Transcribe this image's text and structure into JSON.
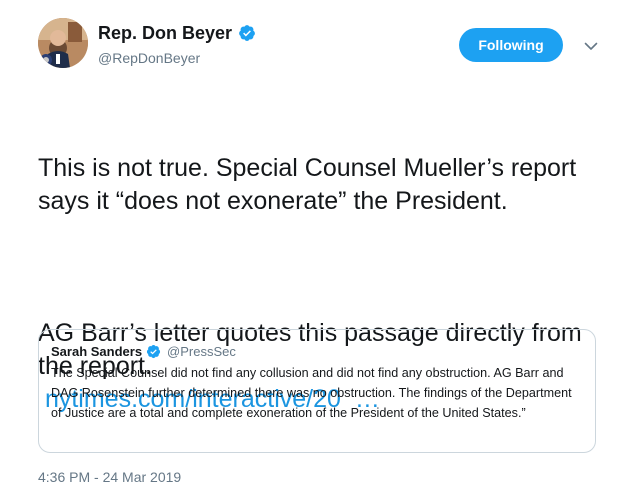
{
  "author": {
    "display_name": "Rep. Don Beyer",
    "handle": "@RepDonBeyer",
    "verified_icon": "verified-badge-icon"
  },
  "follow_button": {
    "label": "Following",
    "color": "#1da1f2"
  },
  "tweet": {
    "paragraph_1": "This is not true. Special Counsel Mueller’s report says it “does not exonerate” the President.",
    "paragraph_2": "AG Barr’s letter quotes this passage directly from the report.",
    "link_text": "nytimes.com/interactive/20",
    "link_ellipsis": "…",
    "link_color": "#1b95e0"
  },
  "quoted_tweet": {
    "display_name": "Sarah Sanders",
    "handle": "@PressSec",
    "text": "The Special Counsel did not find any collusion and did not find any obstruction. AG Barr and DAG Rosenstein further determined there was no obstruction. The findings of the Department of Justice are a total and complete exoneration of the President of the United States.”"
  },
  "timestamp": "4:36 PM - 24 Mar 2019"
}
